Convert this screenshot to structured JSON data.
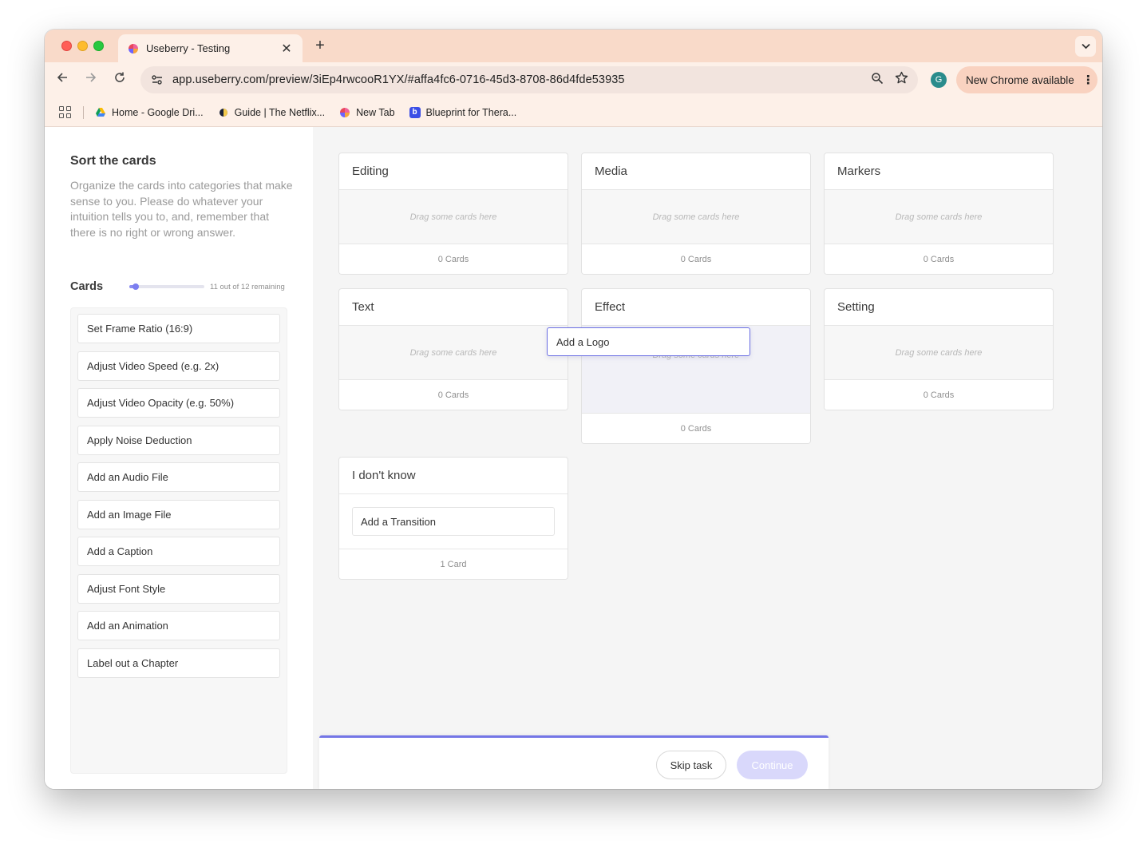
{
  "browser": {
    "tab_title": "Useberry - Testing",
    "url": "app.useberry.com/preview/3iEp4rwcooR1YX/#affa4fc6-0716-45d3-8708-86d4fde53935",
    "profile_initial": "G",
    "update_label": "New Chrome available",
    "bookmarks": [
      {
        "label": "Home - Google Dri...",
        "icon": "google-drive-icon"
      },
      {
        "label": "Guide | The Netflix...",
        "icon": "netflix-guide-icon"
      },
      {
        "label": "New Tab",
        "icon": "useberry-icon"
      },
      {
        "label": "Blueprint for Thera...",
        "icon": "blueprint-icon"
      }
    ]
  },
  "task": {
    "title": "Sort the cards",
    "description": "Organize the cards into categories that make sense to you. Please do whatever your intuition tells you to, and, remember that there is no right or wrong answer.",
    "cards_label": "Cards",
    "remaining_text": "11 out of 12 remaining",
    "progress_fraction": 0.083
  },
  "cards": [
    "Set Frame Ratio (16:9)",
    "Adjust Video Speed (e.g. 2x)",
    "Adjust Video Opacity (e.g. 50%)",
    "Apply Noise Deduction",
    "Add an Audio File",
    "Add an Image File",
    "Add a Caption",
    "Adjust Font Style",
    "Add an Animation",
    "Label out a Chapter"
  ],
  "categories": {
    "editing": {
      "title": "Editing",
      "placeholder": "Drag some cards here",
      "count": "0 Cards"
    },
    "media": {
      "title": "Media",
      "placeholder": "Drag some cards here",
      "count": "0 Cards"
    },
    "markers": {
      "title": "Markers",
      "placeholder": "Drag some cards here",
      "count": "0 Cards"
    },
    "text": {
      "title": "Text",
      "placeholder": "Drag some cards here",
      "count": "0 Cards"
    },
    "effect": {
      "title": "Effect",
      "placeholder": "Drag some cards here",
      "count": "0 Cards"
    },
    "setting": {
      "title": "Setting",
      "placeholder": "Drag some cards here",
      "count": "0 Cards"
    },
    "dont_know": {
      "title": "I don't know",
      "card": "Add a Transition",
      "count": "1 Card"
    }
  },
  "dragging_card": "Add a Logo",
  "footer": {
    "skip_label": "Skip task",
    "continue_label": "Continue"
  },
  "colors": {
    "accent": "#7476e6",
    "continue_disabled": "#d9d8fb",
    "tab_strip": "#f9dac9"
  }
}
